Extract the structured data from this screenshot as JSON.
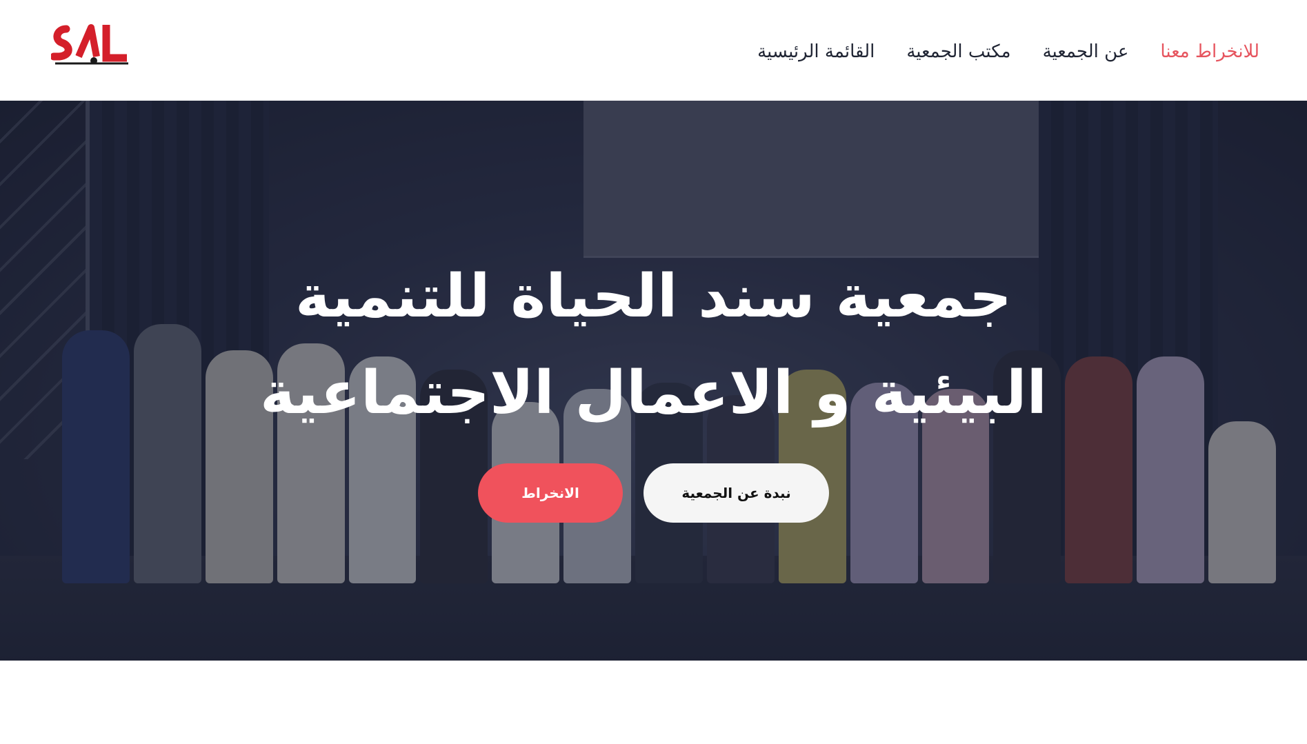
{
  "header": {
    "logo_text": "S A L",
    "nav": [
      {
        "label": "القائمة الرئيسية",
        "active": false
      },
      {
        "label": "مكتب الجمعية",
        "active": false
      },
      {
        "label": "عن الجمعية",
        "active": false
      },
      {
        "label": "للانخراط معنا",
        "active": true
      }
    ]
  },
  "hero": {
    "title_line1": "جمعية سند الحياة للتنمية",
    "title_line2": "البيئية و الاعمال الاجتماعية",
    "buttons": {
      "join_label": "الانخراط",
      "about_label": "نبدة عن الجمعية"
    }
  },
  "colors": {
    "accent": "#f0525c",
    "nav_text": "#1f2433",
    "overlay": "#1c2137"
  },
  "icons": [
    "logo-icon"
  ]
}
